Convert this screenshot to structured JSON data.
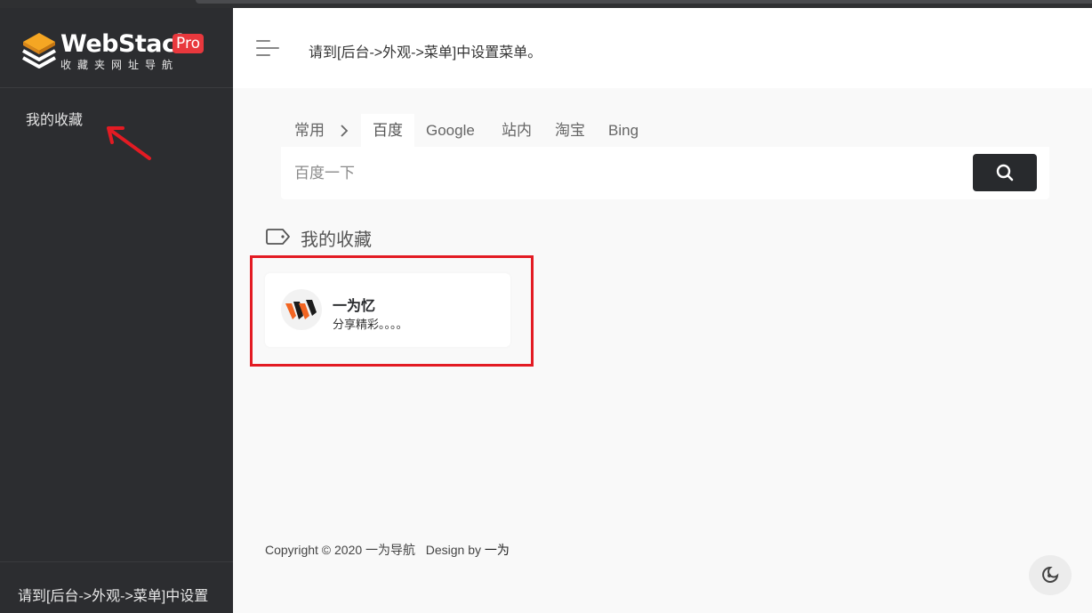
{
  "logo": {
    "name": "WebStack",
    "badge": "Pro",
    "subtitle": "收藏夹网址导航"
  },
  "sidebar": {
    "items": [
      {
        "label": "我的收藏"
      }
    ],
    "footer": "请到[后台->外观->菜单]中设置"
  },
  "header": {
    "title": "请到[后台->外观->菜单]中设置菜单。"
  },
  "search": {
    "group_label": "常用",
    "tabs": [
      "百度",
      "Google",
      "站内",
      "淘宝",
      "Bing"
    ],
    "active_tab": "百度",
    "placeholder": "百度一下"
  },
  "section": {
    "title": "我的收藏",
    "cards": [
      {
        "name": "一为忆",
        "description": "分享精彩。。。。"
      }
    ]
  },
  "footer": {
    "copyright": "Copyright © 2020 一为导航",
    "design_by": "Design by",
    "designer": "一为"
  },
  "colors": {
    "sidebar_bg": "#2c2d30",
    "accent_red": "#e31b23",
    "logo_orange": "#f5a623",
    "button_dark": "#282a2d"
  },
  "icons": [
    "logo-layers-icon",
    "arrow-annotation-icon",
    "menu-icon",
    "chevron-right-icon",
    "search-icon",
    "tag-icon",
    "avatar-logo-icon",
    "moon-icon"
  ]
}
